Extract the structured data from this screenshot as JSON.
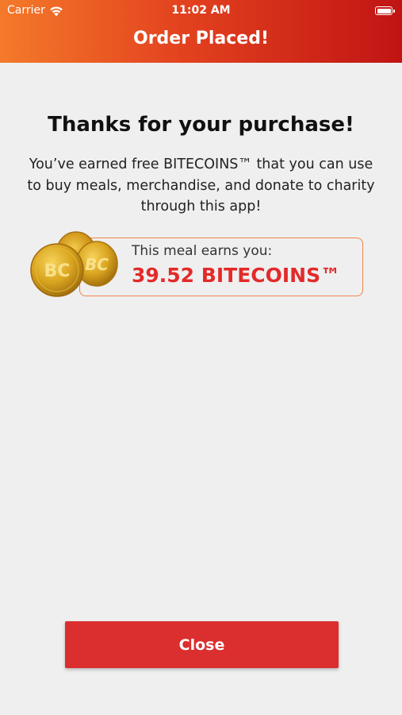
{
  "status_bar": {
    "carrier": "Carrier",
    "time": "11:02 AM"
  },
  "header": {
    "title": "Order Placed!"
  },
  "confirmation": {
    "title": "Thanks for your purchase!",
    "body": "You’ve earned free BITECOINS™ that you can use to buy meals, merchandise, and donate to charity through this app!"
  },
  "earnings": {
    "label": "This meal earns you:",
    "amount": "39.52 BITECOINS™",
    "coin_text": "BC"
  },
  "actions": {
    "close_label": "Close"
  },
  "colors": {
    "header_gradient_start": "#f47a2a",
    "header_gradient_end": "#c01414",
    "accent_red": "#e32a2a",
    "button_red": "#db2e2e",
    "box_border": "#f0844b",
    "background": "#efefef"
  },
  "icons": {
    "wifi": "wifi-icon",
    "battery": "battery-icon",
    "coins": "bitecoin-coins-icon"
  }
}
